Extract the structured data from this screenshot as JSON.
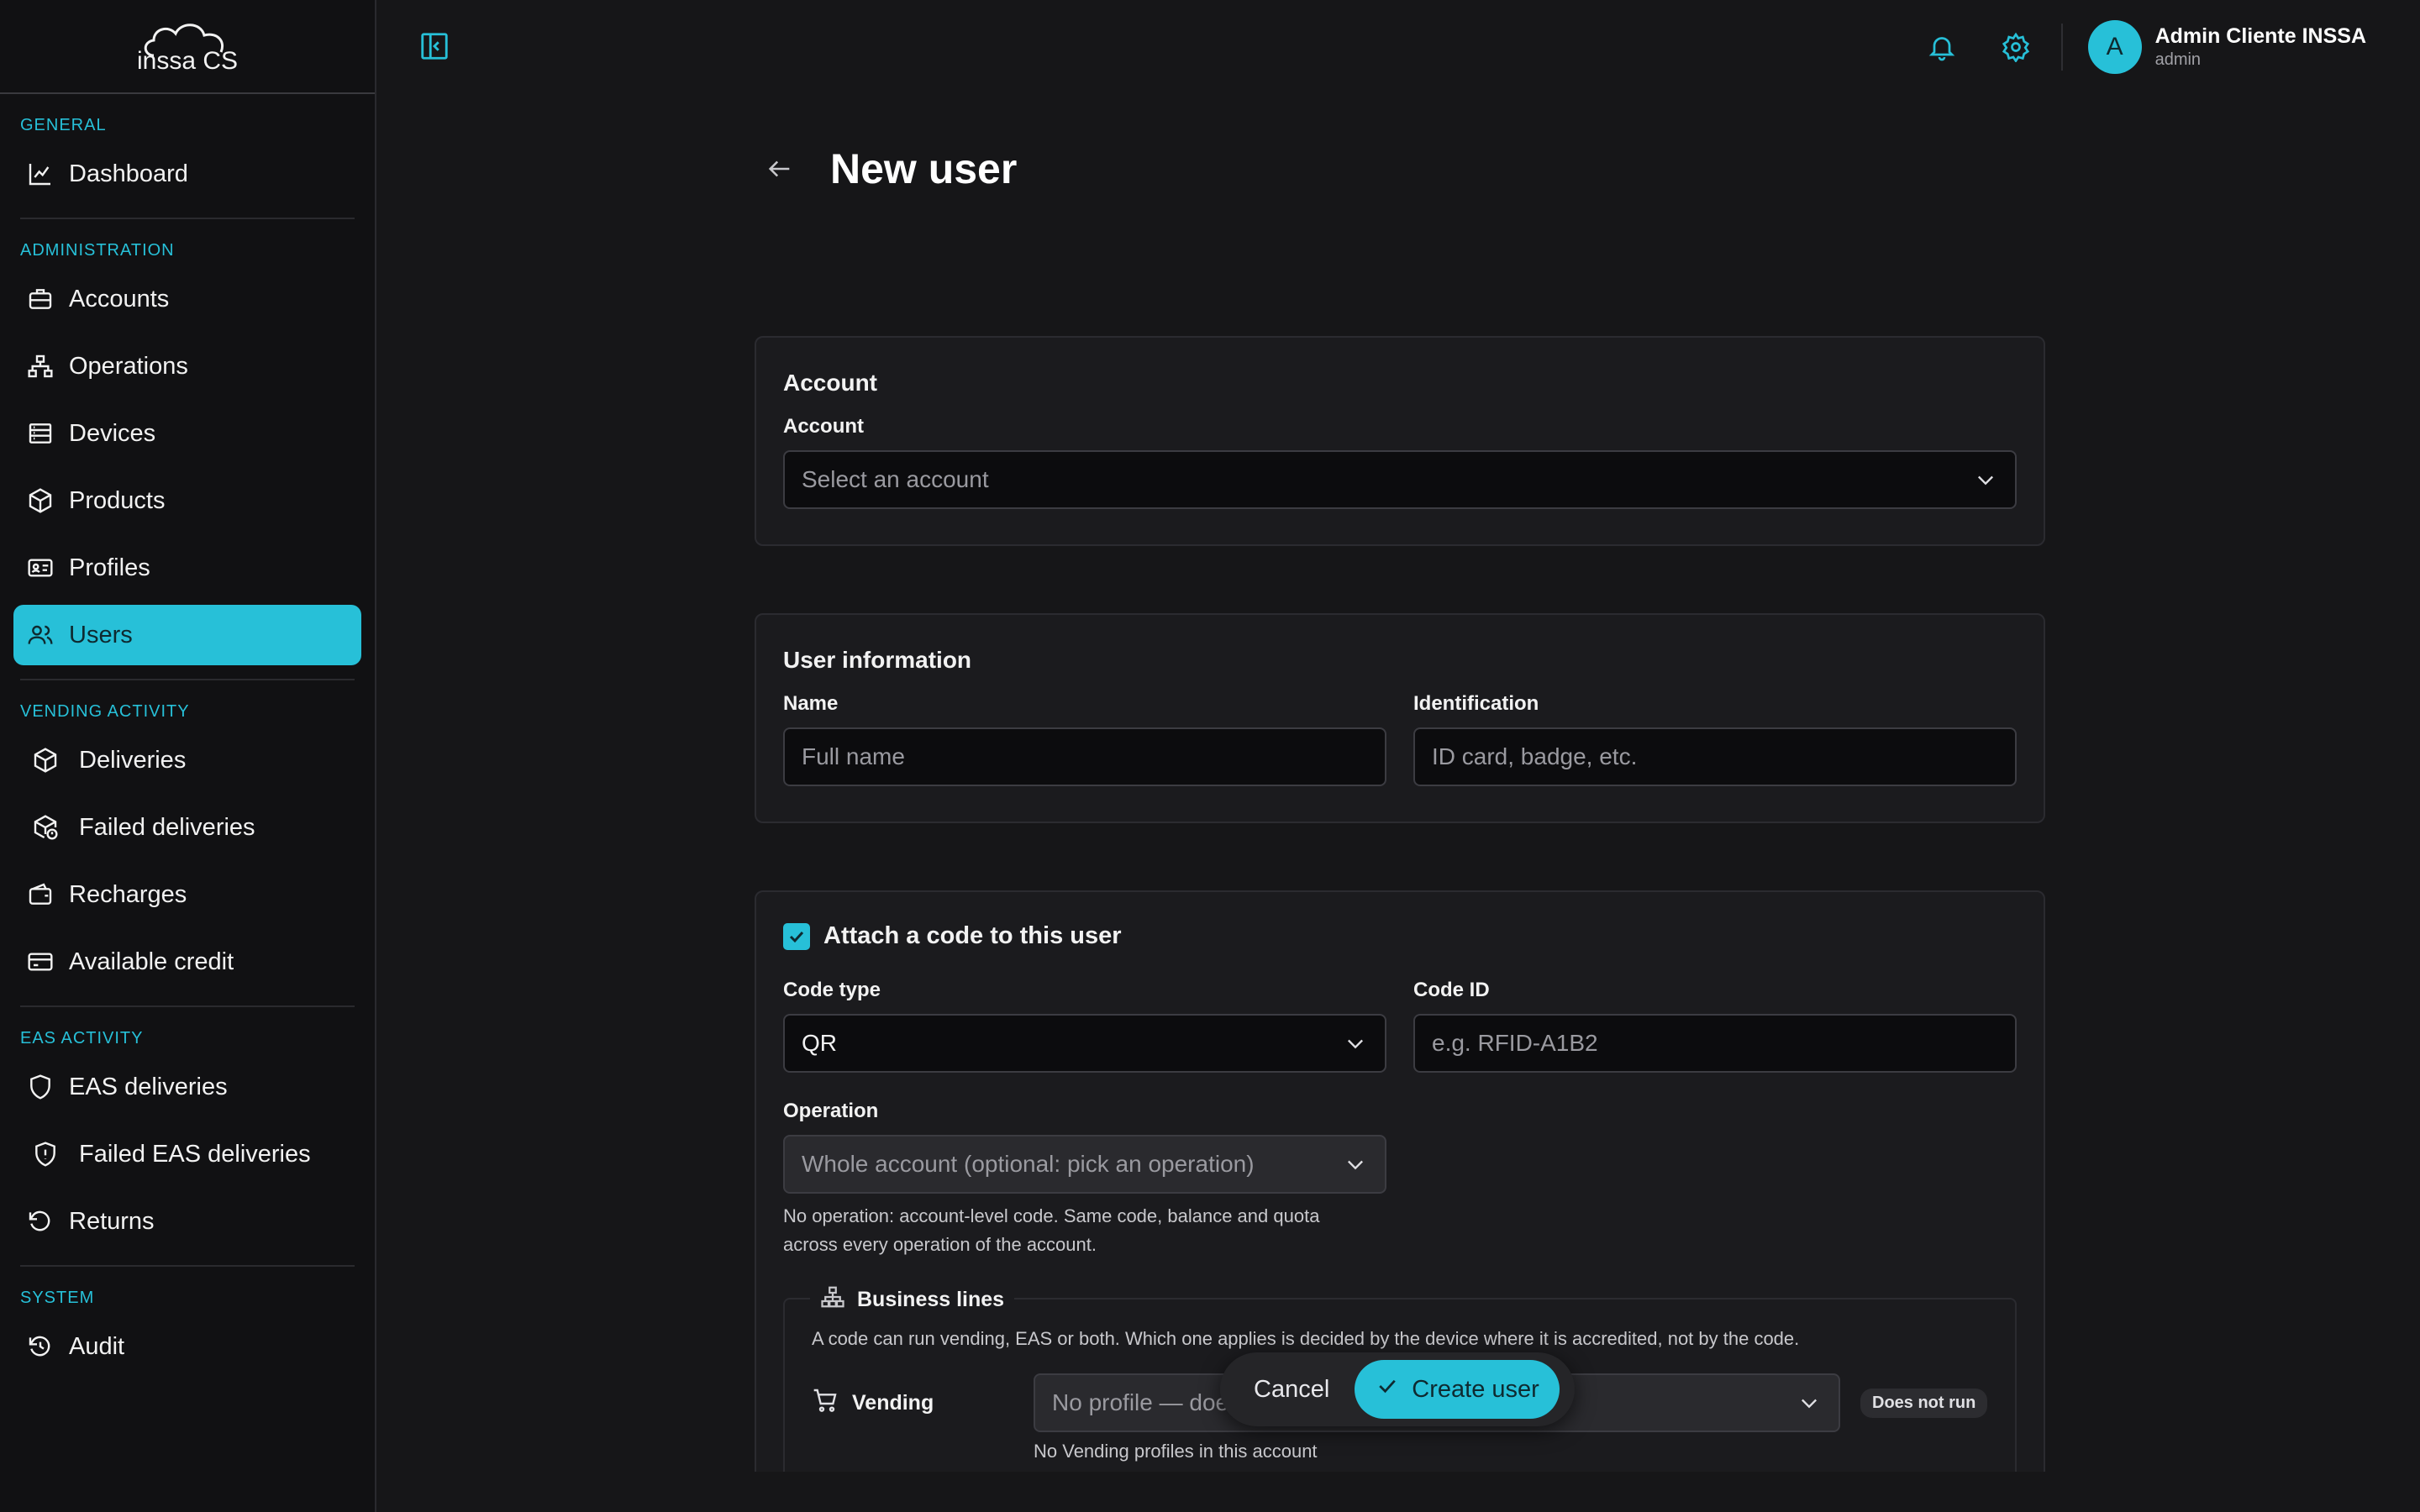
{
  "app": {
    "logo_text": "inssa CS"
  },
  "sidebar": {
    "sections": [
      {
        "label": "GENERAL",
        "items": [
          {
            "label": "Dashboard"
          }
        ]
      },
      {
        "label": "ADMINISTRATION",
        "items": [
          {
            "label": "Accounts"
          },
          {
            "label": "Operations"
          },
          {
            "label": "Devices"
          },
          {
            "label": "Products"
          },
          {
            "label": "Profiles"
          },
          {
            "label": "Users",
            "active": true
          }
        ]
      },
      {
        "label": "VENDING ACTIVITY",
        "items": [
          {
            "label": "Deliveries"
          },
          {
            "label": "Failed deliveries"
          },
          {
            "label": "Recharges"
          },
          {
            "label": "Available credit"
          }
        ]
      },
      {
        "label": "EAS ACTIVITY",
        "items": [
          {
            "label": "EAS deliveries"
          },
          {
            "label": "Failed EAS deliveries"
          },
          {
            "label": "Returns"
          }
        ]
      },
      {
        "label": "SYSTEM",
        "items": [
          {
            "label": "Audit"
          }
        ]
      }
    ]
  },
  "topbar": {
    "user": {
      "initial": "A",
      "name": "Admin Cliente INSSA",
      "role": "admin"
    }
  },
  "page": {
    "title": "New user"
  },
  "account_card": {
    "title": "Account",
    "account_label": "Account",
    "account_placeholder": "Select an account"
  },
  "user_info_card": {
    "title": "User information",
    "name_label": "Name",
    "name_placeholder": "Full name",
    "identification_label": "Identification",
    "identification_placeholder": "ID card, badge, etc."
  },
  "code_card": {
    "attach_label": "Attach a code to this user",
    "attach_checked": true,
    "code_type_label": "Code type",
    "code_type_value": "QR",
    "code_id_label": "Code ID",
    "code_id_placeholder": "e.g. RFID-A1B2",
    "operation_label": "Operation",
    "operation_placeholder": "Whole account (optional: pick an operation)",
    "operation_help": "No operation: account-level code. Same code, balance and quota across every operation of the account.",
    "business_lines": {
      "title": "Business lines",
      "description": "A code can run vending, EAS or both. Which one applies is decided by the device where it is accredited, not by the code.",
      "vending_label": "Vending",
      "vending_placeholder": "No profile — doe",
      "vending_badge": "Does not run",
      "vending_note": "No Vending profiles in this account"
    }
  },
  "actions": {
    "cancel": "Cancel",
    "create": "Create user"
  },
  "colors": {
    "accent": "#27c0d8",
    "background": "#161618",
    "sidebar": "#111113",
    "card": "#1b1b1e"
  }
}
